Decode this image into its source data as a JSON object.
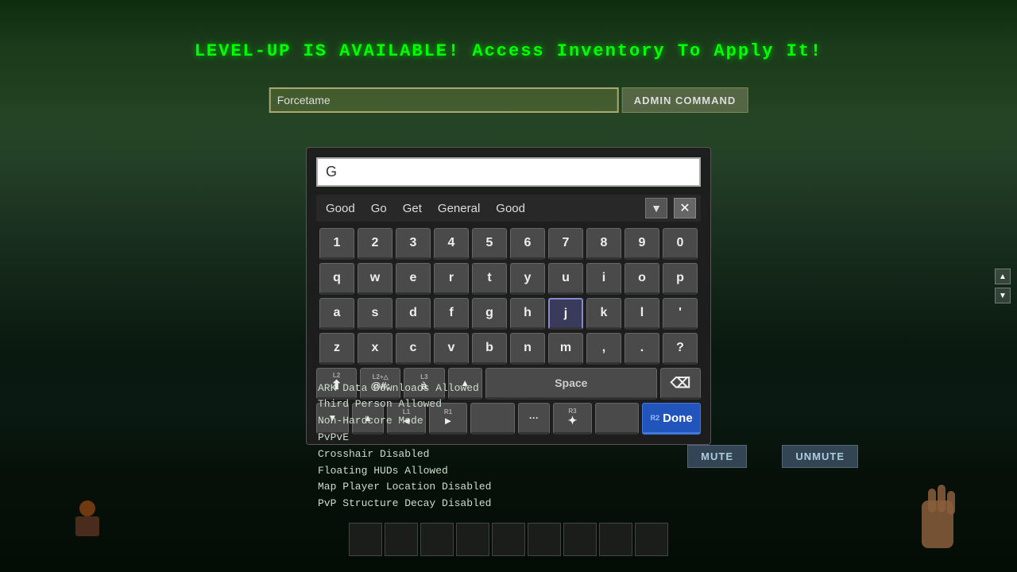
{
  "banner": {
    "text": "LEVEL-UP IS AVAILABLE!  Access Inventory To Apply It!"
  },
  "admin_bar": {
    "input_value": "Forcetame",
    "button_label": "ADMIN COMMAND"
  },
  "keyboard": {
    "search_value": "G",
    "autocomplete": [
      "Good",
      "Go",
      "Get",
      "General",
      "Good"
    ],
    "rows": {
      "numbers": [
        "1",
        "2",
        "3",
        "4",
        "5",
        "6",
        "7",
        "8",
        "9",
        "0"
      ],
      "row1": [
        "q",
        "w",
        "e",
        "r",
        "t",
        "y",
        "u",
        "i",
        "o",
        "p"
      ],
      "row2": [
        "a",
        "s",
        "d",
        "f",
        "g",
        "h",
        "j",
        "k",
        "l",
        "'"
      ],
      "row3": [
        "z",
        "x",
        "c",
        "v",
        "b",
        "n",
        "m",
        ",",
        ".",
        "?"
      ]
    },
    "space_label": "Space",
    "done_label": "Done",
    "bottom_keys": [
      {
        "top": "L2",
        "main": "↑",
        "symbol": "⬆"
      },
      {
        "top": "L2+△",
        "main": "@#:",
        "symbol": "@#:"
      },
      {
        "top": "L3",
        "main": "à",
        "symbol": "à"
      },
      {
        "main": "▲",
        "symbol": "▲"
      },
      {
        "top": "L1",
        "main": "◄",
        "symbol": "◄"
      },
      {
        "top": "R1",
        "main": "►",
        "symbol": "►"
      },
      {
        "main": "..."
      },
      {
        "top": "R3",
        "main": "✦"
      },
      {
        "main": ""
      },
      {
        "top": "R2",
        "main": "Done"
      }
    ],
    "highlighted_key": "j"
  },
  "server_info": {
    "lines": [
      "ARK  Data  Downloads  Allowed",
      "Third  Person  Allowed",
      "Non-Hardcore  Mode",
      "PvPvE",
      "Crosshair  Disabled",
      "Floating  HUDs  Allowed",
      "Map  Player  Location  Disabled",
      "PvP  Structure  Decay  Disabled"
    ]
  },
  "audio_controls": {
    "mute_label": "MUTE",
    "unmute_label": "UNMUTE"
  }
}
